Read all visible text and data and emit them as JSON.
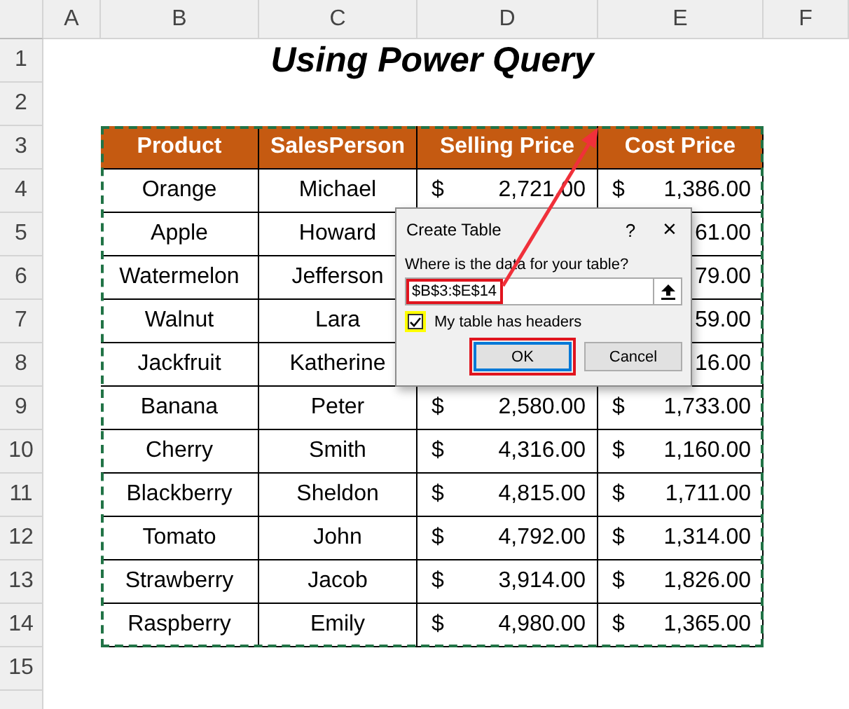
{
  "sheet": {
    "columns": [
      "A",
      "B",
      "C",
      "D",
      "E",
      "F"
    ],
    "row_numbers": [
      "1",
      "2",
      "3",
      "4",
      "5",
      "6",
      "7",
      "8",
      "9",
      "10",
      "11",
      "12",
      "13",
      "14",
      "15"
    ],
    "title": "Using Power Query",
    "table": {
      "headers": [
        "Product",
        "SalesPerson",
        "Selling Price",
        "Cost Price"
      ],
      "rows": [
        {
          "product": "Orange",
          "salesperson": "Michael",
          "selling_price": {
            "symbol": "$",
            "amount": "2,721.00"
          },
          "cost_price": {
            "symbol": "$",
            "amount": "1,386.00"
          }
        },
        {
          "product": "Apple",
          "salesperson": "Howard",
          "cost_price": {
            "amount": "61.00"
          }
        },
        {
          "product": "Watermelon",
          "salesperson": "Jefferson",
          "cost_price": {
            "amount": "79.00"
          }
        },
        {
          "product": "Walnut",
          "salesperson": "Lara",
          "cost_price": {
            "amount": "59.00"
          }
        },
        {
          "product": "Jackfruit",
          "salesperson": "Katherine",
          "cost_price": {
            "amount": "16.00"
          }
        },
        {
          "product": "Banana",
          "salesperson": "Peter",
          "selling_price": {
            "symbol": "$",
            "amount": "2,580.00"
          },
          "cost_price": {
            "symbol": "$",
            "amount": "1,733.00"
          }
        },
        {
          "product": "Cherry",
          "salesperson": "Smith",
          "selling_price": {
            "symbol": "$",
            "amount": "4,316.00"
          },
          "cost_price": {
            "symbol": "$",
            "amount": "1,160.00"
          }
        },
        {
          "product": "Blackberry",
          "salesperson": "Sheldon",
          "selling_price": {
            "symbol": "$",
            "amount": "4,815.00"
          },
          "cost_price": {
            "symbol": "$",
            "amount": "1,711.00"
          }
        },
        {
          "product": "Tomato",
          "salesperson": "John",
          "selling_price": {
            "symbol": "$",
            "amount": "4,792.00"
          },
          "cost_price": {
            "symbol": "$",
            "amount": "1,314.00"
          }
        },
        {
          "product": "Strawberry",
          "salesperson": "Jacob",
          "selling_price": {
            "symbol": "$",
            "amount": "3,914.00"
          },
          "cost_price": {
            "symbol": "$",
            "amount": "1,826.00"
          }
        },
        {
          "product": "Raspberry",
          "salesperson": "Emily",
          "selling_price": {
            "symbol": "$",
            "amount": "4,980.00"
          },
          "cost_price": {
            "symbol": "$",
            "amount": "1,365.00"
          }
        }
      ]
    }
  },
  "dialog": {
    "title": "Create Table",
    "help": "?",
    "close": "×",
    "prompt": "Where is the data for your table?",
    "range": "$B$3:$E$14",
    "has_headers": {
      "label": "My table has headers",
      "checked": true
    },
    "buttons": [
      {
        "label": "OK",
        "default": true
      },
      {
        "label": "Cancel",
        "default": false
      }
    ]
  }
}
